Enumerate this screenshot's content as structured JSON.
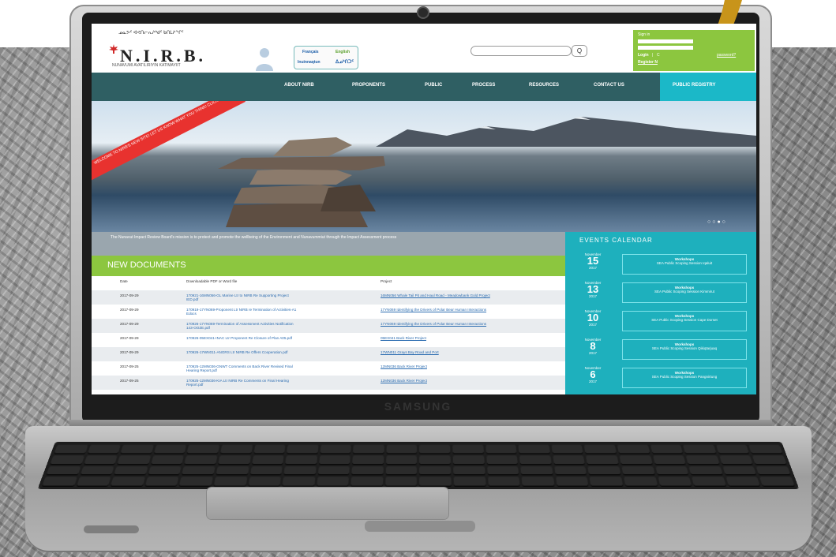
{
  "device": {
    "brand": "SAMSUNG"
  },
  "site": {
    "logo": {
      "main": "N.I.R.B.",
      "arc": "ᓄᓇᕗᑦ ᐊᕙᑎᓕᕆᔨᒃᑯᑦ ᑲᑎᒪᔨᖏᑦ",
      "sub": "NUNAVUMI AVATILIRIYIN KATIMAYIIT"
    },
    "languages": {
      "fr": "Français",
      "en": "English",
      "iu": "Inuinnaqtun",
      "in": "ᐃᓄᒃᑎᑐᑦ"
    },
    "search": {
      "button": "Q"
    },
    "signin": {
      "title": "Sign in",
      "login": "Login",
      "sep": "|",
      "rest": "C",
      "forgot": "password?",
      "register": "Register N"
    },
    "nav": {
      "about": "ABOUT NIRB",
      "proponents": "PROPONENTS",
      "public": "PUBLIC",
      "process": "PROCESS",
      "resources": "RESOURCES",
      "contact": "CONTACT US",
      "registry": "PUBLIC REGISTRY"
    },
    "banner": "WELCOME TO NIRB'S NEW SITE! LET US KNOW WHAT YOU THINK! CLICK HERE!",
    "mission": "The Nunavut Impact Review Board's mission is to protect and promote the wellbeing of the Environment and Nunavummiut through the Impact Assessment process",
    "new_docs": {
      "title": "NEW DOCUMENTS",
      "headers": {
        "date": "Date",
        "file": "Downloadable PDF or Word file",
        "project": "Project"
      },
      "rows": [
        {
          "date": "2017-09-29",
          "file": "170921-16MN056-GL Marine Ltr to NIRB Re Supporting Project IED.pdf",
          "project": "16MN056 Whale Tail Pit and Haul Road - Meadowbank Gold Project"
        },
        {
          "date": "2017-09-29",
          "file": "170919-17YN069-Proponent Ltr NIRB re Termination of Activities-A1 Edocs",
          "project": "17YN069 Identifying the Drivers of Polar Bear Human Interactions"
        },
        {
          "date": "2017-09-29",
          "file": "170926-17YN069-Termination of Assessment Activities Notification 143-OOZE.pdf",
          "project": "17YN069 Identifying the Drivers of Polar Bear Human Interactions"
        },
        {
          "date": "2017-09-29",
          "file": "170926-05EX041-INAC Ltr Proponent Re Closure of Plan A05.pdf",
          "project": "05EX041 Back River Project"
        },
        {
          "date": "2017-09-29",
          "file": "170926-17WN011-ANGRS Ltr NIRB Re Offers Cooperation.pdf",
          "project": "17WN011 Grays Bay Road and Port"
        },
        {
          "date": "2017-09-25",
          "file": "170925-12MN036-GNWT Comments on Back River Revised Final Hearing Report.pdf",
          "project": "12MN036 Back River Project"
        },
        {
          "date": "2017-09-25",
          "file": "170925-12MN036-KIA Ltr NIRB Re Comments on Final Hearing Report.pdf",
          "project": "12MN036 Back River Project"
        }
      ]
    },
    "events": {
      "title": "EVENTS CALENDAR",
      "items": [
        {
          "month": "November",
          "day": "15",
          "year": "2017",
          "type": "Workshops",
          "name": "SEA Public Scoping Session Iqaluit"
        },
        {
          "month": "November",
          "day": "13",
          "year": "2017",
          "type": "Workshops",
          "name": "SEA Public Scoping Session Kimmirut"
        },
        {
          "month": "November",
          "day": "10",
          "year": "2017",
          "type": "Workshops",
          "name": "SEA Public Scoping Session Cape Dorset"
        },
        {
          "month": "November",
          "day": "8",
          "year": "2017",
          "type": "Workshops",
          "name": "SEA Public Scoping Session Qikiqtarjuaq"
        },
        {
          "month": "November",
          "day": "6",
          "year": "2017",
          "type": "Workshops",
          "name": "SEA Public Scoping Session Pangnirtung"
        }
      ]
    }
  }
}
